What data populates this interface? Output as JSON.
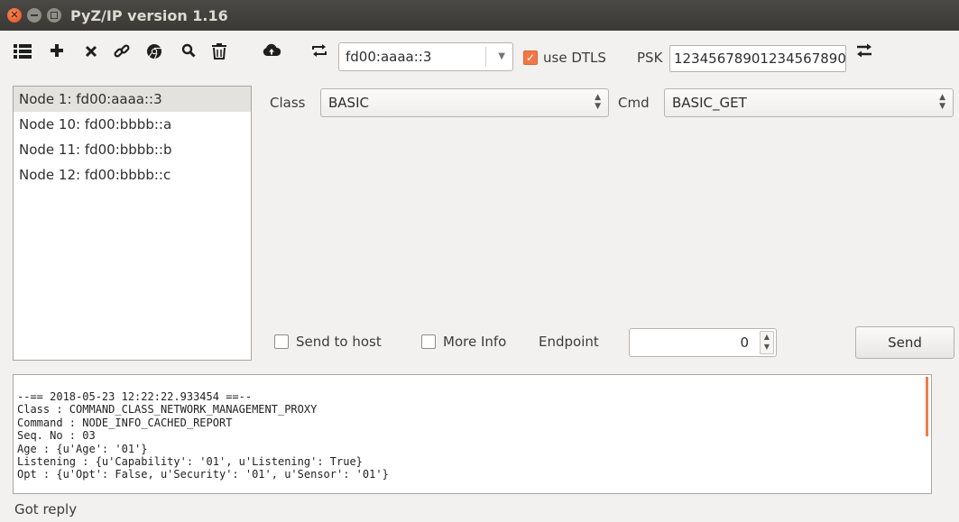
{
  "window": {
    "title": "PyZ/IP version 1.16"
  },
  "toolbar": {
    "icons": [
      "list-icon",
      "add-icon",
      "remove-icon",
      "link-icon",
      "chrome-icon",
      "search-icon",
      "trash-icon",
      "upload-icon",
      "swap-icon"
    ],
    "address": "fd00:aaaa::3",
    "dtls_checked": true,
    "dtls_label": "use DTLS",
    "psk_label": "PSK",
    "psk_value": "12345678901234567890"
  },
  "nodes": [
    "Node 1: fd00:aaaa::3",
    "Node 10: fd00:bbbb::a",
    "Node 11: fd00:bbbb::b",
    "Node 12: fd00:bbbb::c"
  ],
  "form": {
    "class_label": "Class",
    "class_value": "BASIC",
    "cmd_label": "Cmd",
    "cmd_value": "BASIC_GET",
    "send_to_host_label": "Send to host",
    "more_info_label": "More Info",
    "endpoint_label": "Endpoint",
    "endpoint_value": "0",
    "send_label": "Send"
  },
  "log": [
    "--== 2018-05-23 12:22:22.933454 ==--",
    "Class : COMMAND_CLASS_NETWORK_MANAGEMENT_PROXY",
    "Command : NODE_INFO_CACHED_REPORT",
    "Seq. No : 03",
    "Age : {u'Age': '01'}",
    "Listening : {u'Capability': '01', u'Listening': True}",
    "Opt : {u'Opt': False, u'Security': '01', u'Sensor': '01'}"
  ],
  "status": "Got reply",
  "colors": {
    "accent": "#f07746",
    "titlebar": "#3d3c38"
  }
}
